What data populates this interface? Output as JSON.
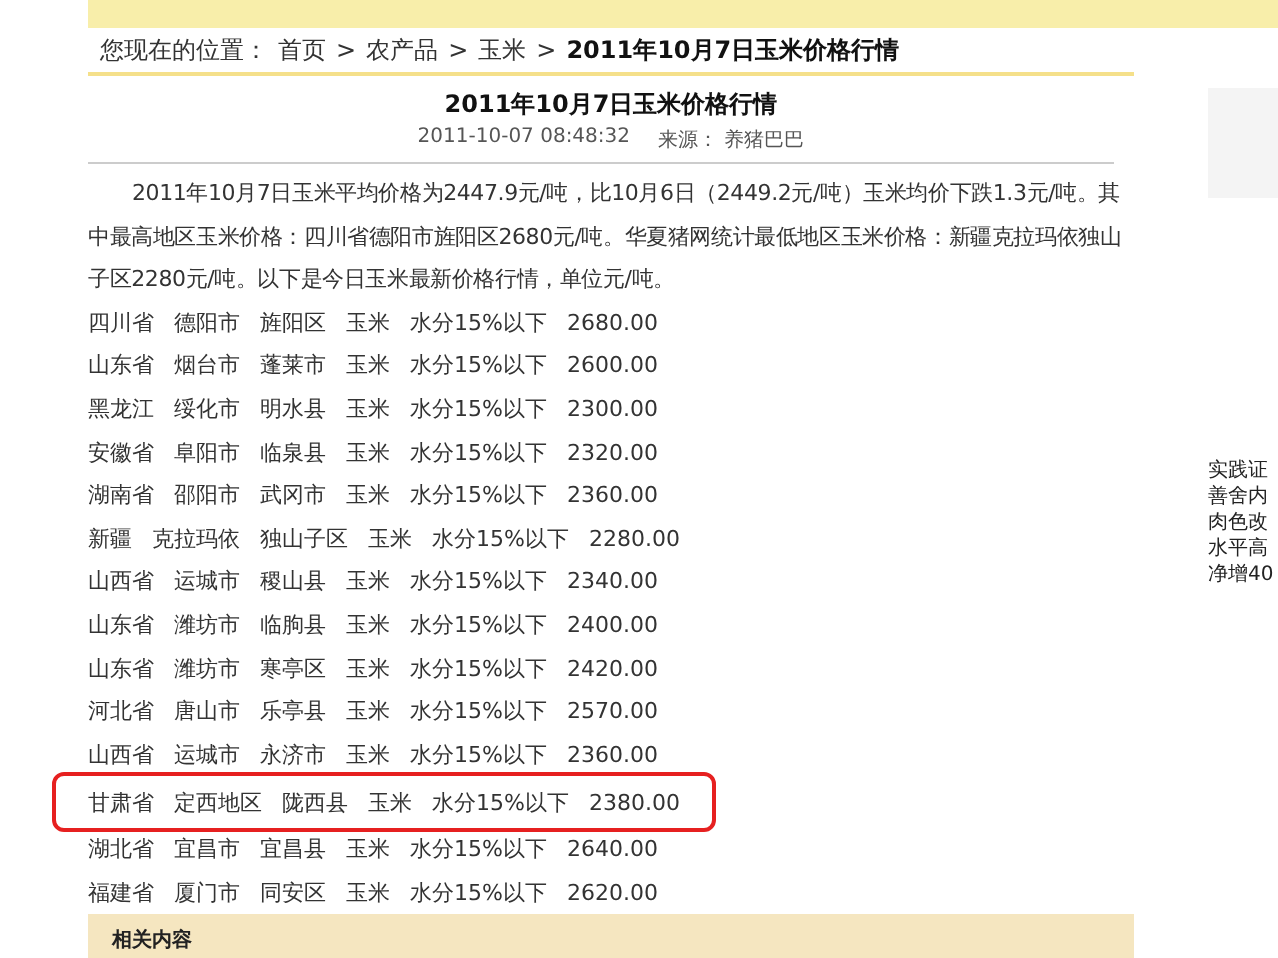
{
  "breadcrumb": {
    "label": "您现在的位置：",
    "separator": ">",
    "links": [
      "首页",
      "农产品",
      "玉米"
    ],
    "current": "2011年10月7日玉米价格行情"
  },
  "article": {
    "title": "2011年10月7日玉米价格行情",
    "date": "2011-10-07 08:48:32",
    "source_label": "来源：",
    "source": "养猪巴巴",
    "intro": "2011年10月7日玉米平均价格为2447.9元/吨，比10月6日（2449.2元/吨）玉米均价下跌1.3元/吨。其中最高地区玉米价格：四川省德阳市旌阳区2680元/吨。华夏猪网统计最低地区玉米价格：新疆克拉玛依独山子区2280元/吨。以下是今日玉米最新价格行情，单位元/吨。",
    "rows": [
      {
        "cells": [
          "四川省",
          "德阳市",
          "旌阳区",
          "玉米",
          "水分15%以下",
          "2680.00"
        ],
        "highlighted": false
      },
      {
        "cells": [
          "山东省",
          "烟台市",
          "蓬莱市",
          "玉米",
          "水分15%以下",
          "2600.00"
        ],
        "highlighted": false
      },
      {
        "cells": [
          "黑龙江",
          "绥化市",
          "明水县",
          "玉米",
          "水分15%以下",
          "2300.00"
        ],
        "highlighted": false
      },
      {
        "cells": [
          "安徽省",
          "阜阳市",
          "临泉县",
          "玉米",
          "水分15%以下",
          "2320.00"
        ],
        "highlighted": false
      },
      {
        "cells": [
          "湖南省",
          "邵阳市",
          "武冈市",
          "玉米",
          "水分15%以下",
          "2360.00"
        ],
        "highlighted": false
      },
      {
        "cells": [
          "新疆",
          "克拉玛依",
          "独山子区",
          "玉米",
          "水分15%以下",
          "2280.00"
        ],
        "highlighted": false
      },
      {
        "cells": [
          "山西省",
          "运城市",
          "稷山县",
          "玉米",
          "水分15%以下",
          "2340.00"
        ],
        "highlighted": false
      },
      {
        "cells": [
          "山东省",
          "潍坊市",
          "临朐县",
          "玉米",
          "水分15%以下",
          "2400.00"
        ],
        "highlighted": false
      },
      {
        "cells": [
          "山东省",
          "潍坊市",
          "寒亭区",
          "玉米",
          "水分15%以下",
          "2420.00"
        ],
        "highlighted": false
      },
      {
        "cells": [
          "河北省",
          "唐山市",
          "乐亭县",
          "玉米",
          "水分15%以下",
          "2570.00"
        ],
        "highlighted": false
      },
      {
        "cells": [
          "山西省",
          "运城市",
          "永济市",
          "玉米",
          "水分15%以下",
          "2360.00"
        ],
        "highlighted": false
      },
      {
        "cells": [
          "甘肃省",
          "定西地区",
          "陇西县",
          "玉米",
          "水分15%以下",
          "2380.00"
        ],
        "highlighted": true
      },
      {
        "cells": [
          "湖北省",
          "宜昌市",
          "宜昌县",
          "玉米",
          "水分15%以下",
          "2640.00"
        ],
        "highlighted": false
      },
      {
        "cells": [
          "福建省",
          "厦门市",
          "同安区",
          "玉米",
          "水分15%以下",
          "2620.00"
        ],
        "highlighted": false
      }
    ],
    "related_heading": "相关内容"
  },
  "sidebar": {
    "snippet_lines": [
      "实践证",
      "善舍内",
      "肉色改",
      "水平高",
      "净增40"
    ]
  }
}
